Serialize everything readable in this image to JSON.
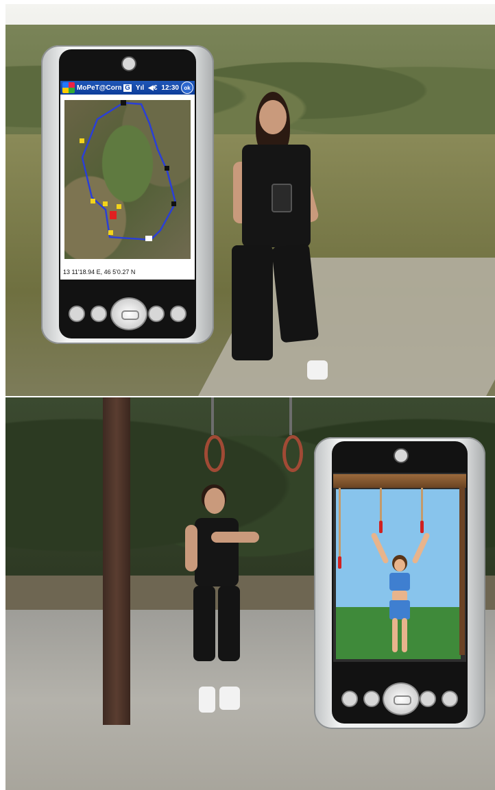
{
  "top_panel": {
    "pda": {
      "taskbar": {
        "title": "MoPeT@Cormor",
        "status_g": "G",
        "signal": "Yıl",
        "volume": "◀€",
        "time": "12:30",
        "ok": "ok"
      },
      "map": {
        "route_color": "#2a3fd6",
        "coordinates": "13 11'18.94 E, 46 5'0.27 N"
      }
    }
  },
  "bottom_panel": {
    "pda": {
      "scene": "3d-exercise-avatar",
      "sky_color": "#88c4ec",
      "grass_color": "#3f8a3a"
    }
  }
}
